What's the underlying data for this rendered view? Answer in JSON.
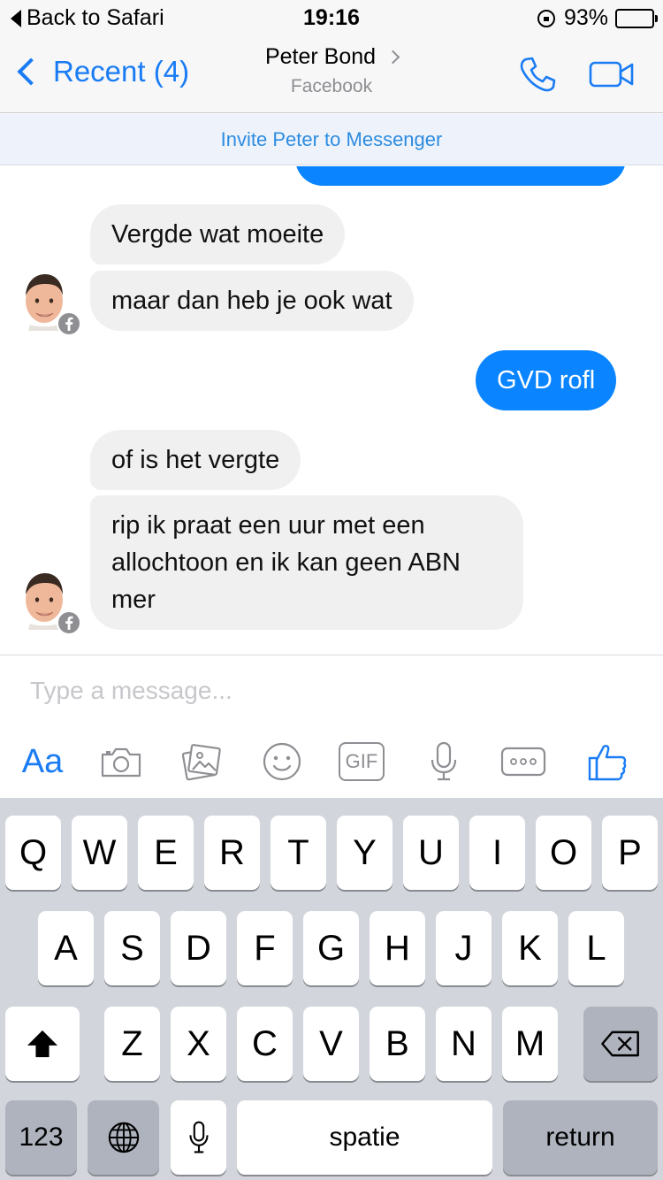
{
  "status_bar": {
    "back_label": "Back to Safari",
    "time": "19:16",
    "battery": "93%",
    "battery_level": 0.93,
    "battery_color": "#f6c700"
  },
  "nav": {
    "back_label": "Recent (4)",
    "contact_name": "Peter Bond",
    "contact_source": "Facebook",
    "accent_color": "#1a7cf4",
    "call_icon": "phone-icon",
    "video_icon": "video-camera-icon"
  },
  "invite_banner": "Invite Peter to Messenger",
  "messages": [
    {
      "side": "in",
      "text": "Vergde wat moeite"
    },
    {
      "side": "in",
      "text": "maar dan heb je ook wat"
    },
    {
      "side": "out",
      "text": "GVD rofl"
    },
    {
      "side": "in",
      "text": "of is het vergte"
    },
    {
      "side": "in",
      "lines": [
        "rip ik praat een uur met een",
        "allochtoon en ik kan geen ABN",
        "mer"
      ]
    }
  ],
  "composer": {
    "placeholder": "Type a message...",
    "tools": {
      "text_style": "Aa",
      "camera": "camera-icon",
      "gallery": "gallery-icon",
      "emoji": "emoji-icon",
      "gif": "GIF",
      "mic": "microphone-icon",
      "more": "more-icon",
      "like": "thumbs-up-icon"
    }
  },
  "keyboard": {
    "row1": [
      "Q",
      "W",
      "E",
      "R",
      "T",
      "Y",
      "U",
      "I",
      "O",
      "P"
    ],
    "row2": [
      "A",
      "S",
      "D",
      "F",
      "G",
      "H",
      "J",
      "K",
      "L"
    ],
    "row3": [
      "Z",
      "X",
      "C",
      "V",
      "B",
      "N",
      "M"
    ],
    "numbers": "123",
    "space": "spatie",
    "return": "return",
    "shift_icon": "shift-icon",
    "delete_icon": "delete-icon",
    "globe_icon": "globe-icon",
    "mic_icon": "microphone-icon"
  }
}
